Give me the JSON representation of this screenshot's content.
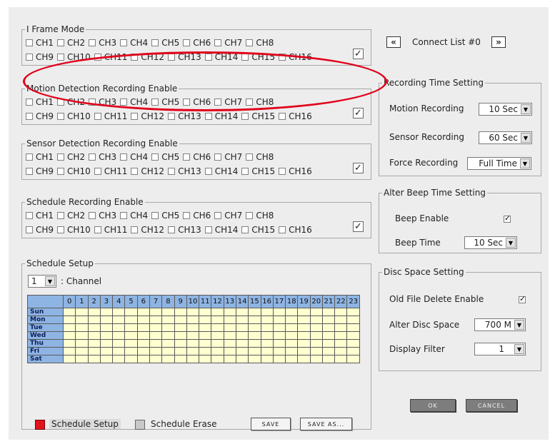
{
  "channel_groups": [
    {
      "title": "I Frame Mode",
      "row1": [
        "CH1",
        "CH2",
        "CH3",
        "CH4",
        "CH5",
        "CH6",
        "CH7",
        "CH8"
      ],
      "row2": [
        "CH9",
        "CH10",
        "CH11",
        "CH12",
        "CH13",
        "CH14",
        "CH15",
        "CH16"
      ],
      "all_checked": true
    },
    {
      "title": "Motion Detection Recording Enable",
      "row1": [
        "CH1",
        "CH2",
        "CH3",
        "CH4",
        "CH5",
        "CH6",
        "CH7",
        "CH8"
      ],
      "row2": [
        "CH9",
        "CH10",
        "CH11",
        "CH12",
        "CH13",
        "CH14",
        "CH15",
        "CH16"
      ],
      "all_checked": true
    },
    {
      "title": "Sensor Detection Recording Enable",
      "row1": [
        "CH1",
        "CH2",
        "CH3",
        "CH4",
        "CH5",
        "CH6",
        "CH7",
        "CH8"
      ],
      "row2": [
        "CH9",
        "CH10",
        "CH11",
        "CH12",
        "CH13",
        "CH14",
        "CH15",
        "CH16"
      ],
      "all_checked": true
    },
    {
      "title": "Schedule Recording Enable",
      "row1": [
        "CH1",
        "CH2",
        "CH3",
        "CH4",
        "CH5",
        "CH6",
        "CH7",
        "CH8"
      ],
      "row2": [
        "CH9",
        "CH10",
        "CH11",
        "CH12",
        "CH13",
        "CH14",
        "CH15",
        "CH16"
      ],
      "all_checked": true
    }
  ],
  "connect": {
    "prev": "«",
    "label": "Connect List #0",
    "next": "»"
  },
  "recording_time": {
    "title": "Recording Time Setting",
    "motion_label": "Motion Recording",
    "motion_value": "10 Sec",
    "sensor_label": "Sensor Recording",
    "sensor_value": "60 Sec",
    "force_label": "Force Recording",
    "force_value": "Full Time"
  },
  "beep": {
    "title": "Alter Beep Time Setting",
    "enable_label": "Beep Enable",
    "enable_checked": true,
    "time_label": "Beep Time",
    "time_value": "10 Sec"
  },
  "disc": {
    "title": "Disc Space Setting",
    "delete_label": "Old File Delete Enable",
    "delete_checked": true,
    "space_label": "Alter Disc Space",
    "space_value": "700 M",
    "filter_label": "Display Filter",
    "filter_value": "1"
  },
  "schedule": {
    "title": "Schedule Setup",
    "channel_value": "1",
    "channel_label": ": Channel",
    "hours": [
      "0",
      "1",
      "2",
      "3",
      "4",
      "5",
      "6",
      "7",
      "8",
      "9",
      "10",
      "11",
      "12",
      "13",
      "14",
      "15",
      "16",
      "17",
      "18",
      "19",
      "20",
      "21",
      "22",
      "23"
    ],
    "days": [
      "Sun",
      "Mon",
      "Tue",
      "Wed",
      "Thu",
      "Fri",
      "Sat"
    ],
    "setup_label": "Schedule Setup",
    "erase_label": "Schedule Erase",
    "save": "SAVE",
    "save_as": "SAVE AS...",
    "setup_color": "#e0141e",
    "erase_color": "#c8c8c8"
  },
  "buttons": {
    "ok": "OK",
    "cancel": "CANCEL"
  },
  "colors": {
    "grid_header": "#8eb4e3",
    "grid_cell": "#ffffd0",
    "annotation": "#e1001a"
  }
}
